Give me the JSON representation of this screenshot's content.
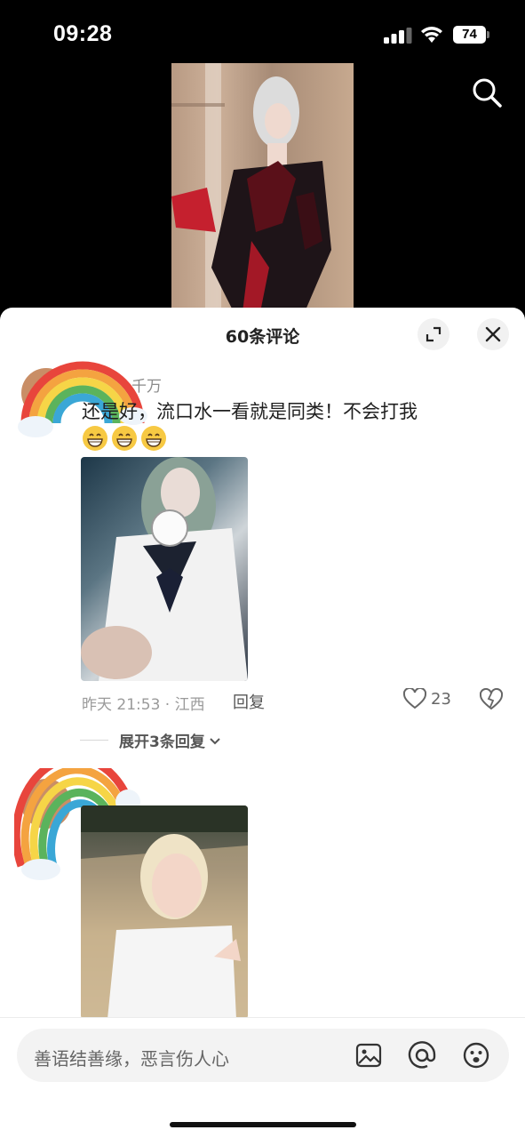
{
  "status_bar": {
    "time": "09:28",
    "battery": "74"
  },
  "sheet": {
    "title": "60条评论"
  },
  "comments": [
    {
      "username": "千万",
      "text": "还是好，流口水一看就是同类！不会打我",
      "emojis": [
        "grinning-face",
        "grinning-face",
        "grinning-face"
      ],
      "time_location": "昨天 21:53 · 江西",
      "reply_label": "回复",
      "likes": "23",
      "expand_label": "展开3条回复"
    },
    {
      "username": "",
      "text": ""
    }
  ],
  "input": {
    "placeholder": "善语结善缘，恶言伤人心"
  },
  "colors": {
    "accent": "#ffffff",
    "sheet_bg": "#ffffff",
    "status_bar_bg": "#000000"
  }
}
